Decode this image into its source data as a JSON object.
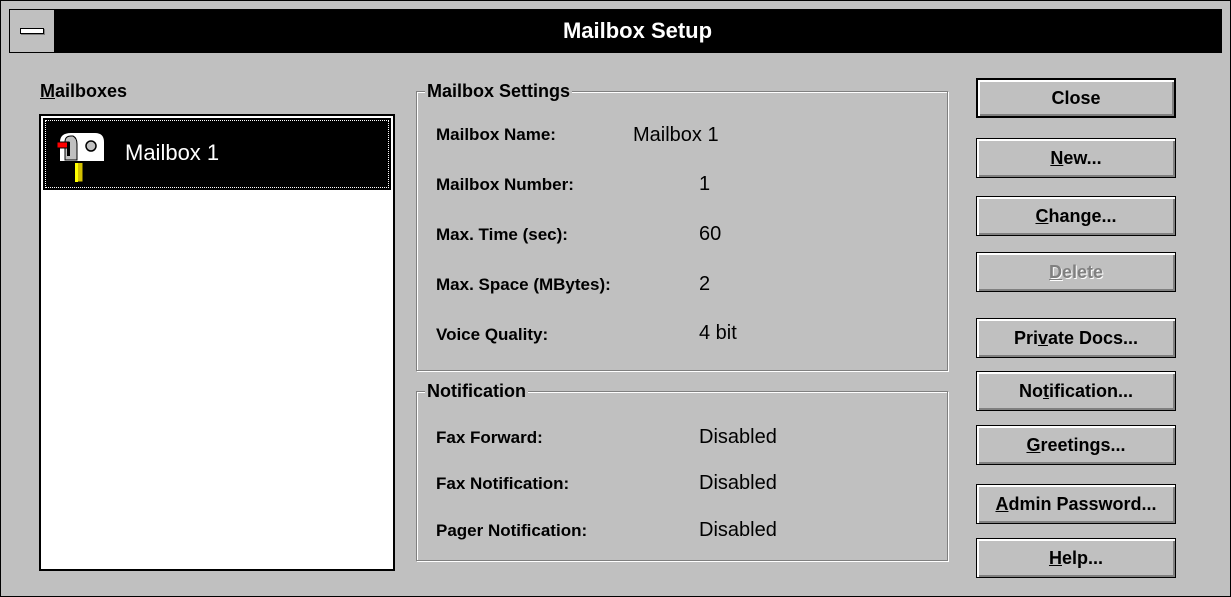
{
  "window": {
    "title": "Mailbox Setup"
  },
  "mailboxes": {
    "label_mnemonic": "M",
    "label_rest": "ailboxes",
    "items": [
      {
        "label": "Mailbox 1",
        "icon": "mailbox-icon",
        "selected": true
      }
    ]
  },
  "settings": {
    "title": "Mailbox Settings",
    "rows": [
      {
        "label": "Mailbox Name:",
        "value": "Mailbox 1"
      },
      {
        "label": "Mailbox Number:",
        "value": "1"
      },
      {
        "label": "Max. Time (sec):",
        "value": "60"
      },
      {
        "label": "Max. Space (MBytes):",
        "value": "2"
      },
      {
        "label": "Voice Quality:",
        "value": "4 bit"
      }
    ]
  },
  "notification": {
    "title": "Notification",
    "rows": [
      {
        "label": "Fax Forward:",
        "value": "Disabled"
      },
      {
        "label": "Fax Notification:",
        "value": "Disabled"
      },
      {
        "label": "Pager Notification:",
        "value": "Disabled"
      }
    ]
  },
  "buttons": {
    "close": {
      "label": "Close"
    },
    "new": {
      "pre": "",
      "mn": "N",
      "post": "ew..."
    },
    "change": {
      "pre": "",
      "mn": "C",
      "post": "hange..."
    },
    "delete": {
      "pre": "",
      "mn": "D",
      "post": "elete",
      "disabled": true
    },
    "private_docs": {
      "pre": "Pri",
      "mn": "v",
      "post": "ate Docs..."
    },
    "notification": {
      "pre": "No",
      "mn": "t",
      "post": "ification..."
    },
    "greetings": {
      "pre": "",
      "mn": "G",
      "post": "reetings..."
    },
    "admin_password": {
      "pre": "",
      "mn": "A",
      "post": "dmin Password..."
    },
    "help": {
      "pre": "",
      "mn": "H",
      "post": "elp..."
    }
  },
  "colors": {
    "face": "#c0c0c0",
    "titlebar": "#000000",
    "selection": "#000000"
  }
}
